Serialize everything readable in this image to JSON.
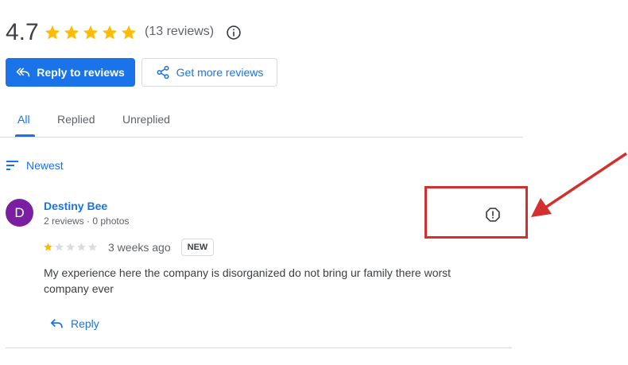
{
  "summary": {
    "rating": "4.7",
    "stars_filled": 5,
    "review_count": "(13 reviews)"
  },
  "actions": {
    "reply_to_reviews": "Reply to reviews",
    "get_more_reviews": "Get more reviews"
  },
  "tabs": [
    {
      "label": "All",
      "active": true
    },
    {
      "label": "Replied",
      "active": false
    },
    {
      "label": "Unreplied",
      "active": false
    }
  ],
  "sort": {
    "label": "Newest"
  },
  "review": {
    "avatar_letter": "D",
    "avatar_color": "#7b1fa2",
    "reviewer": "Destiny Bee",
    "meta": "2 reviews · 0 photos",
    "rating": 1,
    "max_rating": 5,
    "time": "3 weeks ago",
    "badge": "NEW",
    "text": "My experience here the company is disorganized do not bring ur family there worst company ever",
    "reply_label": "Reply"
  },
  "colors": {
    "accent": "#1a73e8",
    "star": "#fbbc04",
    "annotation": "#d32f2f"
  }
}
